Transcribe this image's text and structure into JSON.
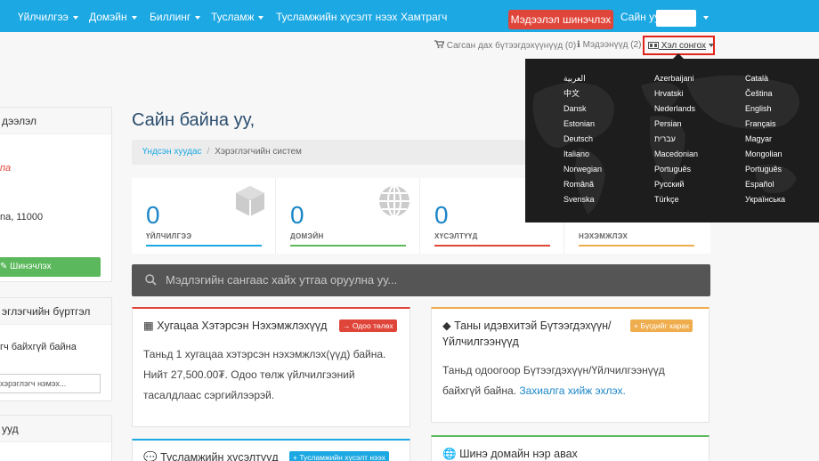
{
  "nav": {
    "items": [
      {
        "label": "Үйлчилгээ",
        "dropdown": true
      },
      {
        "label": "Домэйн",
        "dropdown": true
      },
      {
        "label": "Биллинг",
        "dropdown": true
      },
      {
        "label": "Тусламж",
        "dropdown": true
      },
      {
        "label": "Тусламжийн хүсэлт нээх",
        "dropdown": false
      },
      {
        "label": "Хамтрагч",
        "dropdown": false
      }
    ],
    "notice_button": "Мэдээлэл шинэчлэх",
    "greeting": "Сайн уу,"
  },
  "toplinks": {
    "cart": "Сагсан дах бүтээгдэхүүнүүд (0)",
    "notifications": "Мэдээнүүд (2)",
    "language": "Хэл сонгох"
  },
  "languages": {
    "col1": [
      "العربية",
      "中文",
      "Dansk",
      "Estonian",
      "Deutsch",
      "Italiano",
      "Norwegian",
      "Română",
      "Svenska"
    ],
    "col2": [
      "Azerbaijani",
      "Hrvatski",
      "Nederlands",
      "Persian",
      "עברית",
      "Macedonian",
      "Português",
      "Русский",
      "Türkçe"
    ],
    "col3": [
      "Català",
      "Čeština",
      "English",
      "Français",
      "Magyar",
      "Mongolian",
      "Português",
      "Español",
      "Українська"
    ]
  },
  "sidebar": {
    "info_head": "дээлэл",
    "info_line1": "па",
    "info_line2": "na, 11000",
    "update_button": "Шинэчлэх",
    "contacts_head": "эглэгчийн бүртгэл",
    "contacts_empty": "гч байхгүй байна",
    "contacts_add": "хэрэглэгч нэмэх...",
    "shortcuts_head": "ууд"
  },
  "main": {
    "title": "Сайн байна уу,",
    "breadcrumb_home": "Үндсэн хуудас",
    "breadcrumb_current": "Хэрэглэгчийн систем"
  },
  "stats": [
    {
      "value": "0",
      "label": "ҮЙЛЧИЛГЭЭ",
      "color": "#1ca8e3"
    },
    {
      "value": "0",
      "label": "ДОМЭЙН",
      "color": "#5cb85c"
    },
    {
      "value": "0",
      "label": "ХҮСЭЛТҮҮД",
      "color": "#e0453a"
    },
    {
      "value": "",
      "label": "НЭХЭМЖЛЭХ",
      "color": "#f0ad4e"
    }
  ],
  "kb_search": {
    "placeholder": "Мэдлэгийн сангаас хайх утгаа оруулна уу..."
  },
  "panels": {
    "invoices": {
      "title": "Хугацаа Хэтэрсэн Нэхэмжлэхүүд",
      "badge": "Одоо төлөх",
      "line1": "Таньд 1 хугацаа хэтэрсэн нэхэмжлэх(үүд) байна.",
      "line2": "Нийт 27,500.00₮. Одоо төлж үйлчилгээний",
      "line3": "тасалдлаас сэргийлээрэй."
    },
    "products": {
      "title_line1": "Таны идэвхитэй Бүтээгдэхүүн/",
      "title_line2": "Үйлчилгээнүүд",
      "badge": "Бүгдийг харах",
      "line1": "Таньд одоогоор Бүтээгдэхүүн/Үйлчилгээнүүд",
      "line2": "байхгүй байна.",
      "link": "Захиалга хийж эхлэх."
    },
    "tickets": {
      "title": "Тусламжийн хүсэлтүүд",
      "badge": "Тусламжийн хүсэлт нээх"
    },
    "domain": {
      "title": "Шинэ домайн нэр авах"
    }
  },
  "colors": {
    "brand": "#1ca8e3",
    "danger": "#e0453a",
    "success": "#5cb85c",
    "warning": "#f0ad4e"
  }
}
